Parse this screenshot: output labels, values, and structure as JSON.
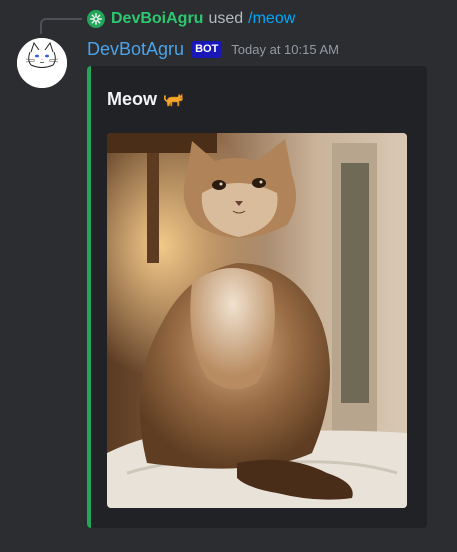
{
  "interaction": {
    "user": "DevBoiAgru",
    "verb": "used",
    "command": "/meow",
    "icon": "app-command-icon"
  },
  "message": {
    "author": "DevBotAgru",
    "bot_tag": "BOT",
    "timestamp": "Today at 10:15 AM",
    "avatar": "cat-sketch-avatar"
  },
  "embed": {
    "title": "Meow",
    "title_emoji": "cat-emoji",
    "accent_color": "#23a55a",
    "image": "fluffy-cat-photo"
  },
  "colors": {
    "background": "#2b2d31",
    "embed_background": "#202226",
    "username": "#4aa3e8",
    "command_user": "#2dc770",
    "command": "#00a8fc",
    "bot_tag": "#1a17b8"
  }
}
